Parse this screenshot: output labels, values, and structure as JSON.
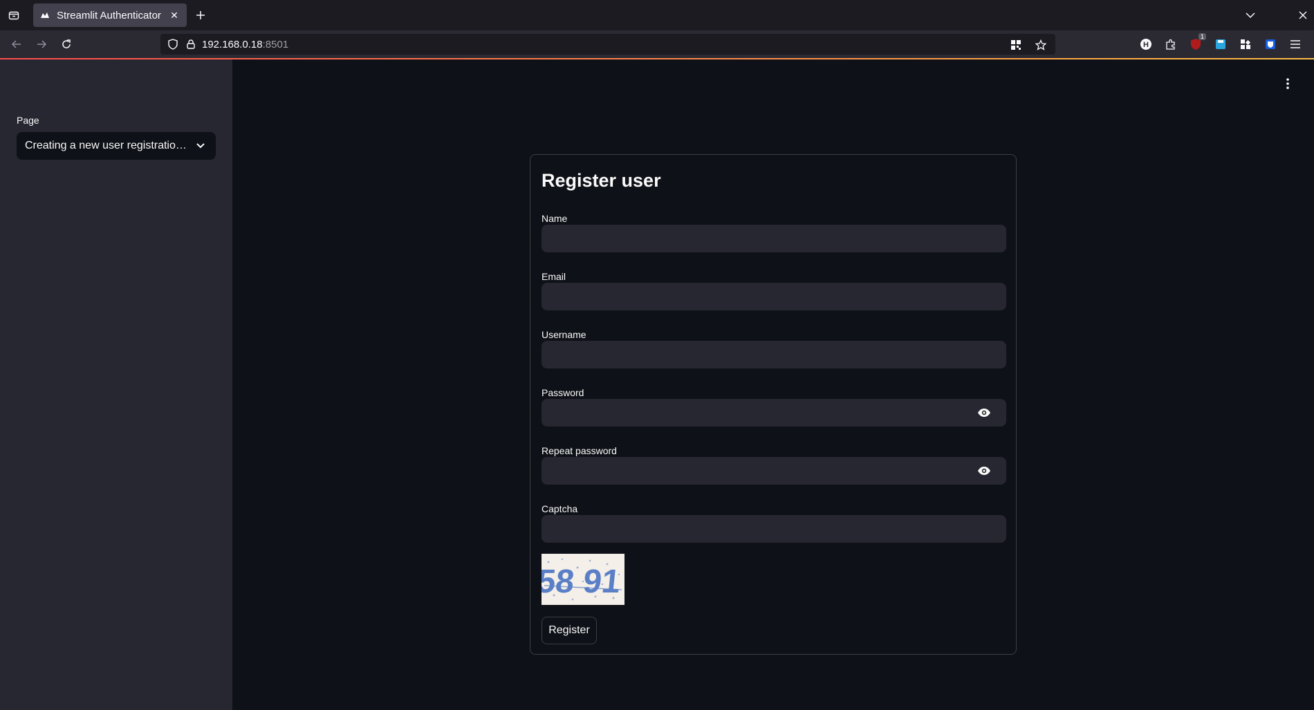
{
  "browser": {
    "tab_title": "Streamlit Authenticator",
    "url_host": "192.168.0.18",
    "url_port": ":8501",
    "extension_badge": "1"
  },
  "sidebar": {
    "page_label": "Page",
    "page_select_value": "Creating a new user registration widget"
  },
  "form": {
    "title": "Register user",
    "fields": {
      "name_label": "Name",
      "email_label": "Email",
      "username_label": "Username",
      "password_label": "Password",
      "repeat_password_label": "Repeat password",
      "captcha_label": "Captcha"
    },
    "captcha_text": "58 91",
    "register_label": "Register"
  },
  "colors": {
    "background": "#0e1117",
    "sidebar": "#262730",
    "input": "#262730",
    "accent_start": "#ff4b4b",
    "accent_end": "#ffbd45",
    "captcha_glyphs": "#5a7fc7"
  }
}
